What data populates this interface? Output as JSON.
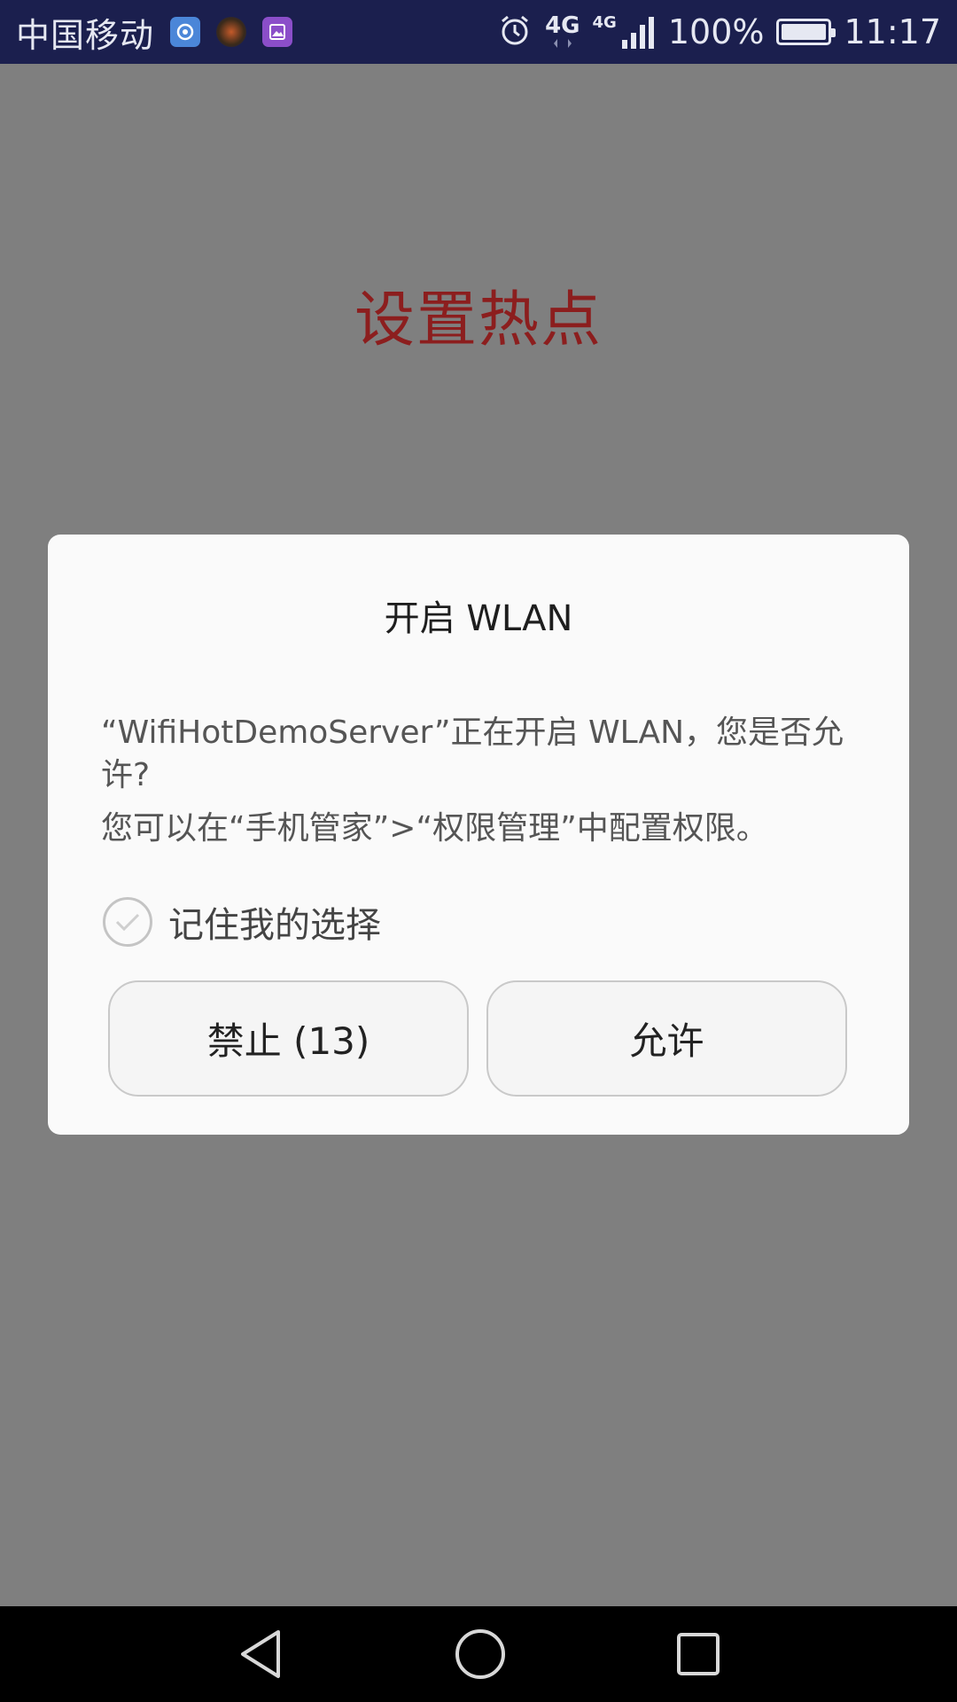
{
  "status_bar": {
    "carrier": "中国移动",
    "network_1": "4G",
    "network_2": "4G",
    "battery_percent": "100%",
    "battery_level": 1.0,
    "time": "11:17",
    "icons": [
      "app-notification-icon",
      "game-notification-icon",
      "gallery-notification-icon",
      "alarm-icon",
      "data-transfer-icon",
      "signal-icon",
      "battery-icon"
    ]
  },
  "page": {
    "title": "设置热点"
  },
  "dialog": {
    "title": "开启 WLAN",
    "message": "“WifiHotDemoServer”正在开启 WLAN，您是否允许?",
    "hint": "您可以在“手机管家”>“权限管理”中配置权限。",
    "remember_label": "记住我的选择",
    "deny_label": "禁止 (13)",
    "allow_label": "允许"
  },
  "navigation": {
    "icons": [
      "back-icon",
      "home-icon",
      "recents-icon"
    ]
  },
  "colors": {
    "status_bar_bg": "#1b1f4e",
    "scrim": "#7f7f7f",
    "title_red": "#8c1e1e",
    "dialog_bg": "#fafafa"
  }
}
